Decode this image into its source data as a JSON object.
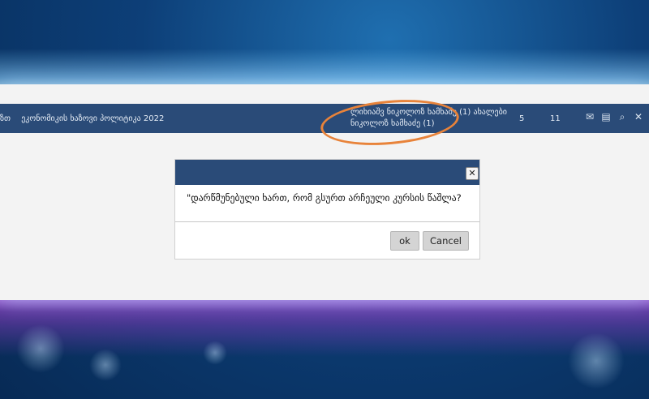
{
  "topbar": {
    "prefix": "ზთ",
    "course_title": "ეკონომიკის ხაზოვი პოლიტიკა 2022",
    "notice_line1": "ლიხიაშვ ნიკოლოზ ხამხაძე (1) ახალები",
    "notice_line2": "ნიკოლოზ ხამხაძე (1)",
    "count1": "5",
    "count2": "11",
    "icons": [
      "mail-icon",
      "print-icon",
      "search-icon",
      "close-icon"
    ]
  },
  "dialog": {
    "message": "\"დარწმუნებული ხართ, რომ გსურთ არჩეული კურსის წაშლა?",
    "ok_label": "ok",
    "cancel_label": "Cancel",
    "close_glyph": "✕"
  },
  "colors": {
    "bar": "#2a4b78",
    "highlight": "#e8833a",
    "button": "#d4d4d4"
  }
}
